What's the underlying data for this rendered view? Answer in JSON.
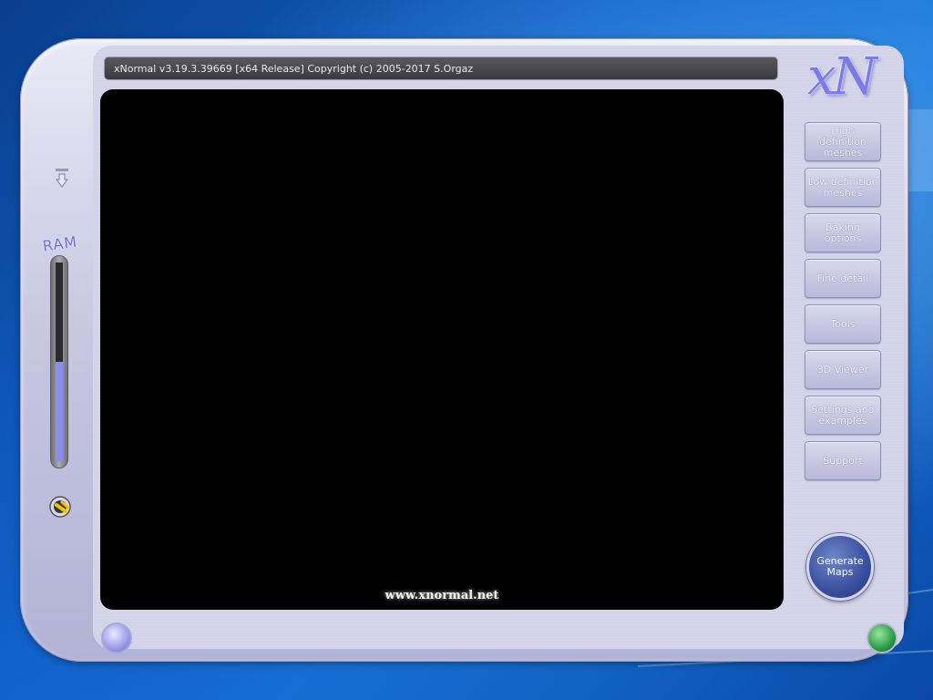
{
  "window": {
    "title": "xNormal v3.19.3.39669 [x64 Release] Copyright (c) 2005-2017 S.Orgaz",
    "logo": "xN"
  },
  "viewport": {
    "website": "www.xnormal.net"
  },
  "sidebar": {
    "items": [
      {
        "label": "High definition meshes"
      },
      {
        "label": "Low definition meshes"
      },
      {
        "label": "Baking options"
      },
      {
        "label": "Fine detail"
      },
      {
        "label": "Tools"
      },
      {
        "label": "3D Viewer"
      },
      {
        "label": "Settings and examples"
      },
      {
        "label": "Support"
      }
    ]
  },
  "actions": {
    "generate_label": "Generate Maps"
  },
  "ram": {
    "label": "RAM",
    "usage_fraction": 0.5
  },
  "colors": {
    "accent": "#8a8cf0",
    "frame": "#c8c8e2",
    "generate_button": "#3e54a2",
    "status_green": "#2c9c4a"
  },
  "icons": {
    "down_arrow": "down-arrow-icon",
    "plug": "plug-icon",
    "left_orb": "minimize-orb-icon",
    "right_orb": "status-orb-icon"
  }
}
